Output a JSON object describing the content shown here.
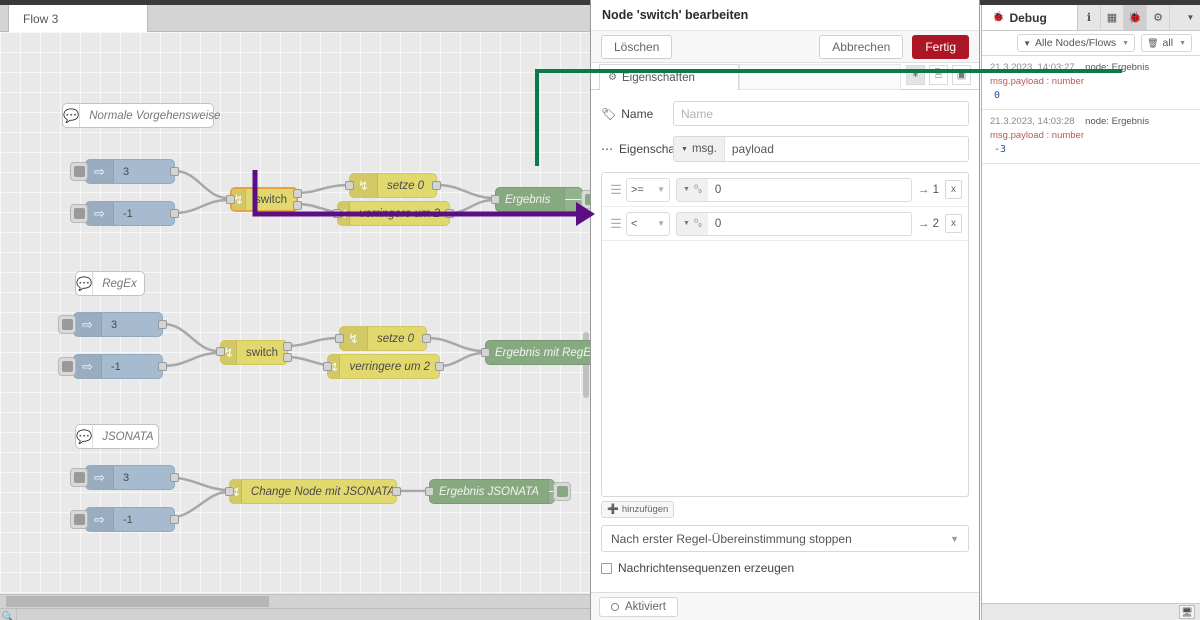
{
  "workspace": {
    "tab_label": "Flow 3",
    "flows": [
      {
        "comment": "Normale Vorgehensweise",
        "inject_top": "3",
        "inject_bottom": "-1",
        "switch": "switch",
        "branch_top": "setze 0",
        "branch_bottom": "verringere um 2",
        "result": "Ergebnis"
      },
      {
        "comment": "RegEx",
        "inject_top": "3",
        "inject_bottom": "-1",
        "switch": "switch",
        "branch_top": "setze 0",
        "branch_bottom": "verringere um 2",
        "result": "Ergebnis mit RegEx"
      },
      {
        "comment": "JSONATA",
        "inject_top": "3",
        "inject_bottom": "-1",
        "change": "Change Node mit JSONATA",
        "result": "Ergebnis JSONATA"
      }
    ],
    "status": {
      "search_icon": "search-icon"
    }
  },
  "dialog": {
    "title": "Node 'switch' bearbeiten",
    "delete_label": "Löschen",
    "cancel_label": "Abbrechen",
    "done_label": "Fertig",
    "tab_label": "Eigenschaften",
    "tab_icon": "gear-icon",
    "icon_buttons": [
      {
        "name": "node-settings-icon",
        "glyph": "✿"
      },
      {
        "name": "node-description-icon",
        "glyph": "🗎"
      },
      {
        "name": "node-appearance-icon",
        "glyph": "⛶"
      }
    ],
    "name_label": "Name",
    "name_icon": "tag-icon",
    "name_value": "",
    "name_placeholder": "Name",
    "property_label": "Eigenschaft",
    "property_icon": "ellipsis-icon",
    "property_type": "msg.",
    "property_value": "payload",
    "rules": [
      {
        "operator": ">=",
        "type_icon": "number-type-icon",
        "value": "0",
        "output": "→ 1",
        "delete": "x"
      },
      {
        "operator": "<",
        "type_icon": "number-type-icon",
        "value": "0",
        "output": "→ 2",
        "delete": "x"
      }
    ],
    "add_label": "hinzufügen",
    "add_icon": "plus-icon",
    "stop_mode": "Nach erster Regel-Übereinstimmung stoppen",
    "checkbox_label": "Nachrichtensequenzen erzeugen",
    "checkbox_checked": false,
    "enabled_label": "Aktiviert"
  },
  "sidebar": {
    "tab_label": "Debug",
    "tab_icon": "bug-icon",
    "tab_icons": [
      {
        "name": "info-icon",
        "glyph": "i"
      },
      {
        "name": "help-icon",
        "glyph": "▤"
      },
      {
        "name": "debug-icon",
        "glyph": "🐞"
      },
      {
        "name": "config-icon",
        "glyph": "⚙"
      }
    ],
    "caret_icon": "chevron-down-icon",
    "filter_label": "Alle Nodes/Flows",
    "filter_icon": "filter-icon",
    "clear_label": "all",
    "clear_icon": "trash-icon",
    "messages": [
      {
        "timestamp": "21.3.2023, 14:03:27",
        "node": "node: Ergebnis",
        "topic": "msg.payload : number",
        "value": "0"
      },
      {
        "timestamp": "21.3.2023, 14:03:28",
        "node": "node: Ergebnis",
        "topic": "msg.payload : number",
        "value": "-3"
      }
    ],
    "footer_icon": "desktop-icon"
  },
  "annotations": {
    "green_color": "#0b7a4b",
    "purple_color": "#5b0f82"
  }
}
